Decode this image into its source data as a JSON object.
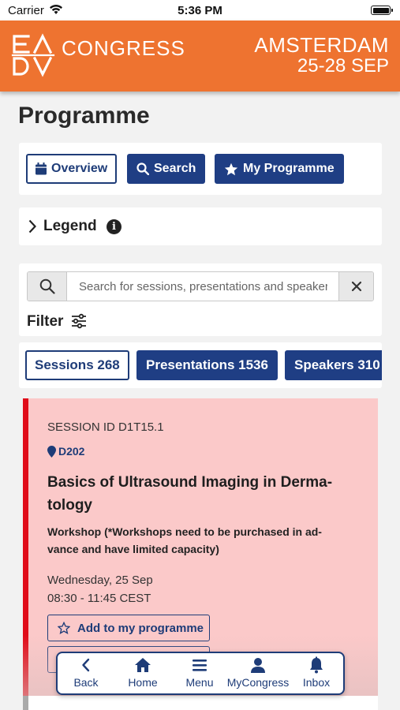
{
  "status_bar": {
    "carrier": "Carrier",
    "time": "5:36 PM"
  },
  "banner": {
    "logo_letters": [
      "E",
      "A",
      "D",
      "V"
    ],
    "title": "CONGRESS",
    "city": "AMSTERDAM",
    "dates": "25-28 SEP",
    "background_color": "#ee7330"
  },
  "page": {
    "title": "Programme"
  },
  "nav": {
    "overview_label": "Overview",
    "search_label": "Search",
    "my_programme_label": "My Programme"
  },
  "legend": {
    "label": "Legend",
    "info_glyph": "i"
  },
  "search": {
    "placeholder": "Search for sessions, presentations and speakers",
    "value": "",
    "filter_label": "Filter"
  },
  "tabs": [
    {
      "label": "Sessions 268",
      "active": true
    },
    {
      "label": "Presentations 1536",
      "active": false
    },
    {
      "label": "Speakers 310",
      "active": false
    }
  ],
  "session": {
    "id_text": "SESSION ID D1T15.1",
    "room": "D202",
    "title": "Basics of Ultrasound Imaging in Derma-tology",
    "type": "Workshop (*Workshops need to be purchased in ad-vance and have limited capacity)",
    "date": "Wednesday, 25 Sep",
    "time": "08:30 - 11:45 CEST",
    "add_label": "Add to my programme",
    "accent_color": "#e00d1a",
    "background_color": "#fbc9c9"
  },
  "bottom_nav": {
    "back": "Back",
    "home": "Home",
    "menu": "Menu",
    "mycongress": "MyCongress",
    "inbox": "Inbox"
  },
  "colors": {
    "primary": "#1f3e84"
  }
}
